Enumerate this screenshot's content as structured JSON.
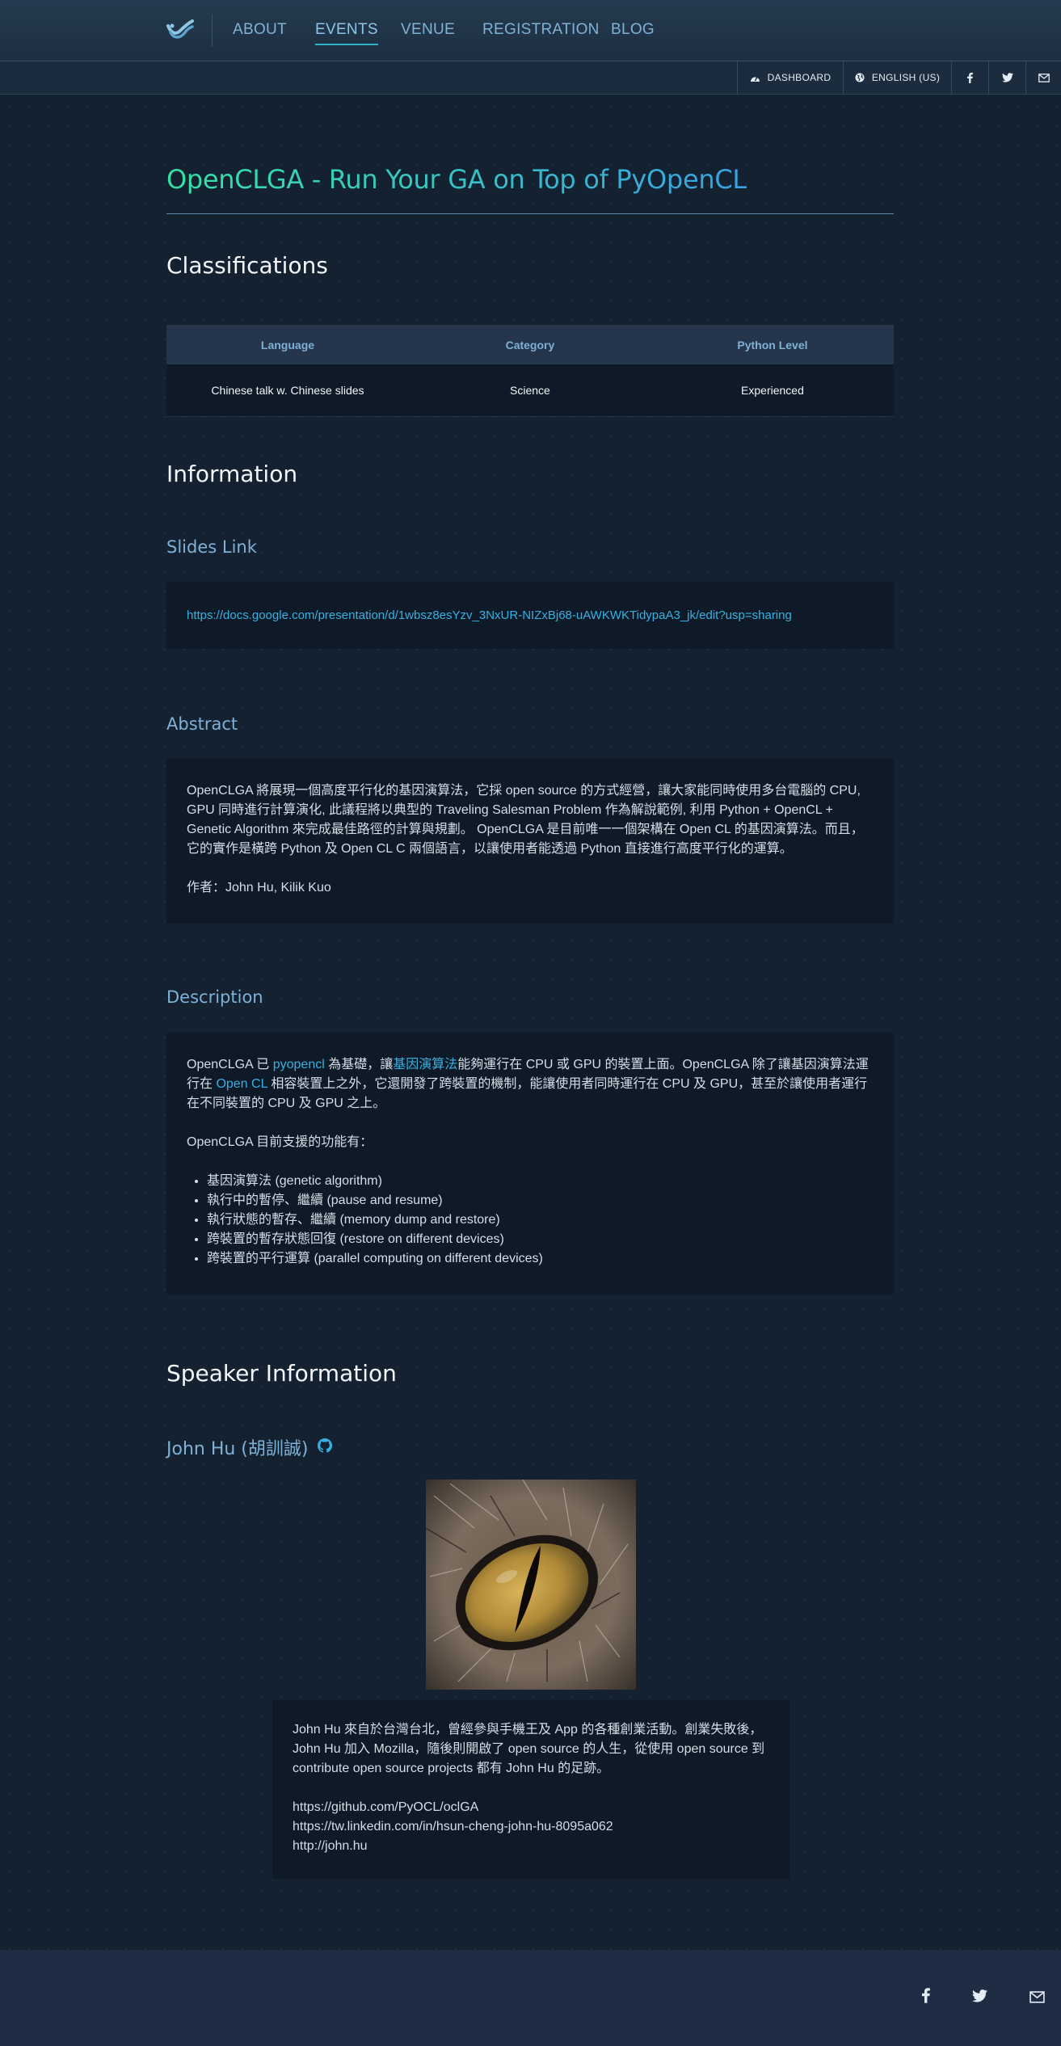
{
  "nav": {
    "items": [
      {
        "label": "ABOUT"
      },
      {
        "label": "EVENTS"
      },
      {
        "label": "VENUE"
      },
      {
        "label": "REGISTRATION"
      },
      {
        "label": "BLOG"
      }
    ],
    "active_index": 1
  },
  "subbar": {
    "dashboard": "DASHBOARD",
    "language": "ENGLISH (US)"
  },
  "page": {
    "title": "OpenCLGA - Run Your GA on Top of PyOpenCL"
  },
  "classifications": {
    "heading": "Classifications",
    "headers": [
      "Language",
      "Category",
      "Python Level"
    ],
    "values": [
      "Chinese talk w. Chinese slides",
      "Science",
      "Experienced"
    ]
  },
  "information": {
    "heading": "Information",
    "slides_heading": "Slides Link",
    "slides_url": "https://docs.google.com/presentation/d/1wbsz8esYzv_3NxUR-NIZxBj68-uAWKWKTidypaA3_jk/edit?usp=sharing",
    "abstract_heading": "Abstract",
    "abstract_lines": [
      "OpenCLGA 將展現一個高度平行化的基因演算法，它採 open source 的方式經營，讓大家能同時使用多台電腦的 CPU,",
      "GPU 同時進行計算演化, 此議程將以典型的 Traveling Salesman Problem 作為解說範例, 利用 Python + OpenCL +",
      "Genetic Algorithm 來完成最佳路徑的計算與規劃。 OpenCLGA 是目前唯一一個架構在 Open CL 的基因演算法。而且，",
      "它的實作是橫跨 Python 及 Open CL C 兩個語言，以讓使用者能透過 Python 直接進行高度平行化的運算。"
    ],
    "abstract_authors": "作者：John Hu, Kilik Kuo",
    "description_heading": "Description",
    "desc_p1_a": "OpenCLGA 已 ",
    "desc_link_pyopencl": "pyopencl",
    "desc_p1_b": " 為基礎，讓",
    "desc_link_ga": "基因演算法",
    "desc_p1_c": "能夠運行在 CPU 或 GPU 的裝置上面。OpenCLGA 除了讓基因演算法運",
    "desc_p1_d": "行在 ",
    "desc_link_opencl": "Open CL",
    "desc_p1_e": " 相容裝置上之外，它還開發了跨裝置的機制，能讓使用者同時運行在 CPU 及 GPU，甚至於讓使用者運行",
    "desc_p1_f": "在不同裝置的 CPU 及 GPU 之上。",
    "desc_p2": "OpenCLGA 目前支援的功能有：",
    "features": [
      "基因演算法 (genetic algorithm)",
      "執行中的暫停、繼續 (pause and resume)",
      "執行狀態的暫存、繼續 (memory dump and restore)",
      "跨裝置的暫存狀態回復 (restore on different devices)",
      "跨裝置的平行運算 (parallel computing on different devices)"
    ]
  },
  "speaker": {
    "heading": "Speaker Information",
    "name": "John Hu (胡訓誠)",
    "bio_lines": [
      "John Hu 來自於台灣台北，曾經參與手機王及 App 的各種創業活動。創業失敗後，",
      "John Hu 加入 Mozilla，隨後則開啟了 open source 的人生，從使用 open source 到",
      "contribute open source projects 都有 John Hu 的足跡。"
    ],
    "links": [
      "https://github.com/PyOCL/oclGA",
      "https://tw.linkedin.com/in/hsun-cheng-john-hu-8095a062",
      "http://john.hu"
    ]
  },
  "colors": {
    "background": "#142131",
    "accent_blue": "#7fb1d6",
    "link": "#37b1e2",
    "title_gradient_start": "#36e2a5",
    "title_gradient_end": "#38a2e2",
    "panel": "#0e1a28",
    "footer": "#1f2d44"
  }
}
